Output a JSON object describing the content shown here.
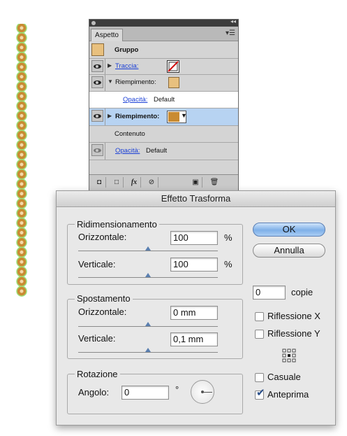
{
  "colors": {
    "gruppo_swatch": "#e8c07e",
    "fill_swatch_light": "#e8c07e",
    "fill_swatch_selected": "#c98b32",
    "selected_row": "#b7d3f2",
    "link": "#1a3fd6",
    "chain_bead": "#c98b32",
    "chain_guide": "#9de07a"
  },
  "aspetto": {
    "tab_label": "Aspetto",
    "rows": {
      "gruppo": "Gruppo",
      "traccia": "Traccia:",
      "riempimento": "Riempimento:",
      "opacita_label": "Opacità:",
      "opacita_value": "Default",
      "riempimento_selected": "Riempimento:",
      "contenuto": "Contenuto",
      "opacita2_label": "Opacità:",
      "opacita2_value": "Default"
    },
    "toolbar_icons": [
      "new-stroke-icon",
      "new-fill-icon",
      "fx-icon",
      "clear-icon",
      "duplicate-icon",
      "trash-icon"
    ],
    "fx_label": "fx"
  },
  "dialog": {
    "title": "Effetto Trasforma",
    "ridimensionamento": {
      "title": "Ridimensionamento",
      "orizzontale_label": "Orizzontale:",
      "orizzontale_value": "100",
      "orizzontale_unit": "%",
      "verticale_label": "Verticale:",
      "verticale_value": "100",
      "verticale_unit": "%"
    },
    "spostamento": {
      "title": "Spostamento",
      "orizzontale_label": "Orizzontale:",
      "orizzontale_value": "0 mm",
      "verticale_label": "Verticale:",
      "verticale_value": "0,1 mm"
    },
    "rotazione": {
      "title": "Rotazione",
      "angolo_label": "Angolo:",
      "angolo_value": "0",
      "degree": "°"
    },
    "ok_label": "OK",
    "annulla_label": "Annulla",
    "copie_value": "0",
    "copie_label": "copie",
    "riflessione_x": "Riflessione X",
    "riflessione_y": "Riflessione Y",
    "casuale": "Casuale",
    "anteprima": "Anteprima",
    "anteprima_checked": true
  }
}
